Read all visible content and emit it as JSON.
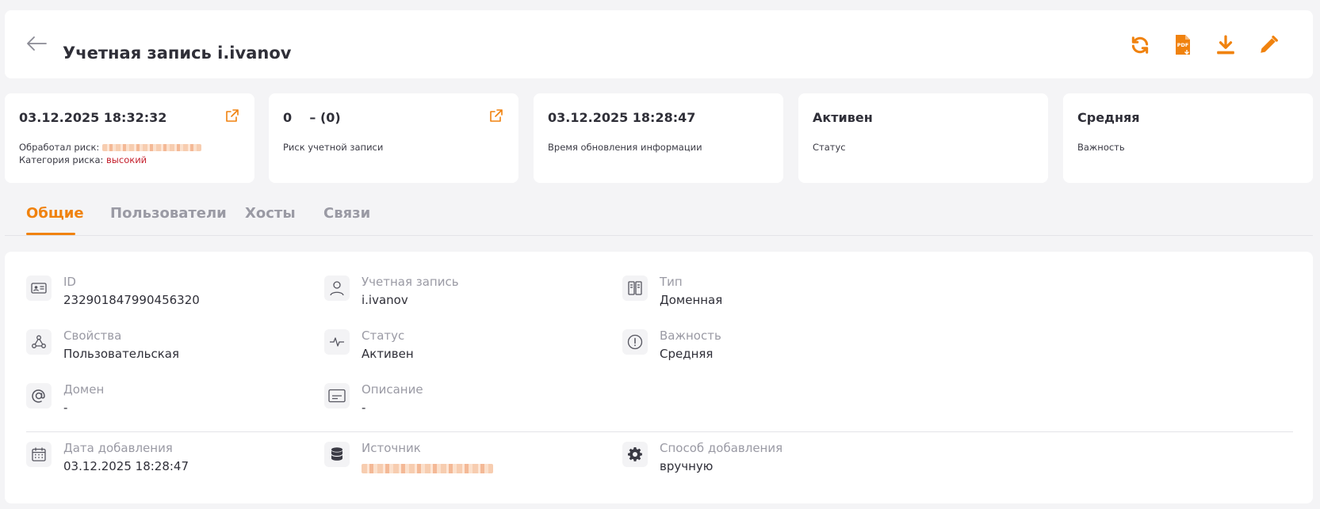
{
  "header": {
    "title": "Учетная запись i.ivanov",
    "accent_color": "#f0820e",
    "actions": [
      {
        "icon": "refresh-icon"
      },
      {
        "icon": "pdf-export-icon",
        "badge": "PDF"
      },
      {
        "icon": "download-icon"
      },
      {
        "icon": "edit-icon"
      }
    ]
  },
  "cards": [
    {
      "value": "03.12.2025 18:32:32",
      "processed_label": "Обработал риск:",
      "category_label": "Категория риска:",
      "category_value": "высокий"
    },
    {
      "value": "0    – (0)",
      "label": "Риск учетной записи"
    },
    {
      "value": "03.12.2025 18:28:47",
      "label": "Время обновления информации"
    },
    {
      "value": "Активен",
      "label": "Статус"
    },
    {
      "value": "Средняя",
      "label": "Важность"
    }
  ],
  "tabs": [
    {
      "label": "Общие",
      "active": true
    },
    {
      "label": "Пользователи",
      "active": false
    },
    {
      "label": "Хосты",
      "active": false
    },
    {
      "label": "Связи",
      "active": false
    }
  ],
  "details": {
    "id": {
      "label": "ID",
      "value": "232901847990456320",
      "icon": "id-card-icon"
    },
    "account": {
      "label": "Учетная запись",
      "value": "i.ivanov",
      "icon": "user-icon"
    },
    "type": {
      "label": "Тип",
      "value": "Доменная",
      "icon": "type-icon"
    },
    "properties": {
      "label": "Свойства",
      "value": "Пользовательская",
      "icon": "properties-icon"
    },
    "status": {
      "label": "Статус",
      "value": "Активен",
      "icon": "pulse-icon"
    },
    "importance": {
      "label": "Важность",
      "value": "Средняя",
      "icon": "alert-circle-icon"
    },
    "domain": {
      "label": "Домен",
      "value": "-",
      "icon": "at-icon"
    },
    "description": {
      "label": "Описание",
      "value": "-",
      "icon": "description-icon"
    },
    "date_added": {
      "label": "Дата добавления",
      "value": "03.12.2025 18:28:47",
      "icon": "calendar-icon"
    },
    "source": {
      "label": "Источник",
      "icon": "database-icon"
    },
    "add_method": {
      "label": "Способ добавления",
      "value": "вручную",
      "icon": "gear-icon"
    }
  }
}
